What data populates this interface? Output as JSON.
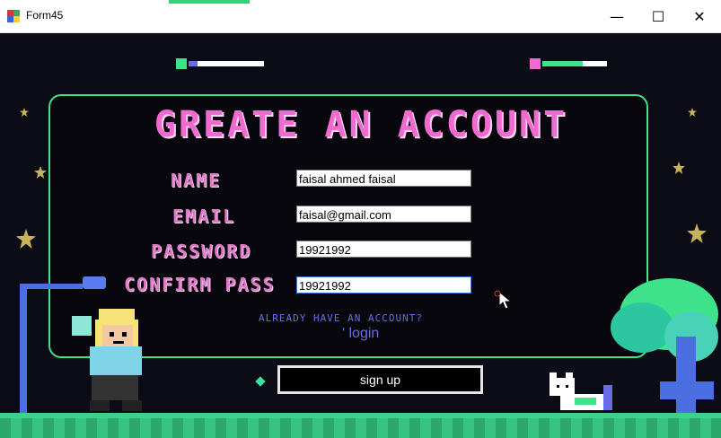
{
  "window": {
    "title": "Form45",
    "controls": {
      "minimize": "—",
      "maximize": "☐",
      "close": "✕"
    }
  },
  "form": {
    "heading": "GREATE AN ACCOUNT",
    "fields": [
      {
        "label": "NAME",
        "value": "faisal ahmed faisal"
      },
      {
        "label": "EMAIL",
        "value": "faisal@gmail.com"
      },
      {
        "label": "PASSWORD",
        "value": "19921992"
      },
      {
        "label": "CONFIRM PASS",
        "value": "19921992"
      }
    ],
    "already_text": "ALREADY HAVE AN ACCOUNT?",
    "login_link": "' login",
    "signup_button": "sign up"
  },
  "colors": {
    "accent_green": "#3de28a",
    "pink": "#f06ad0",
    "link_blue": "#6b6be8",
    "background": "#0c0c16"
  },
  "icons": [
    "app-icon",
    "heart-icon",
    "star-icon",
    "cursor-icon"
  ]
}
